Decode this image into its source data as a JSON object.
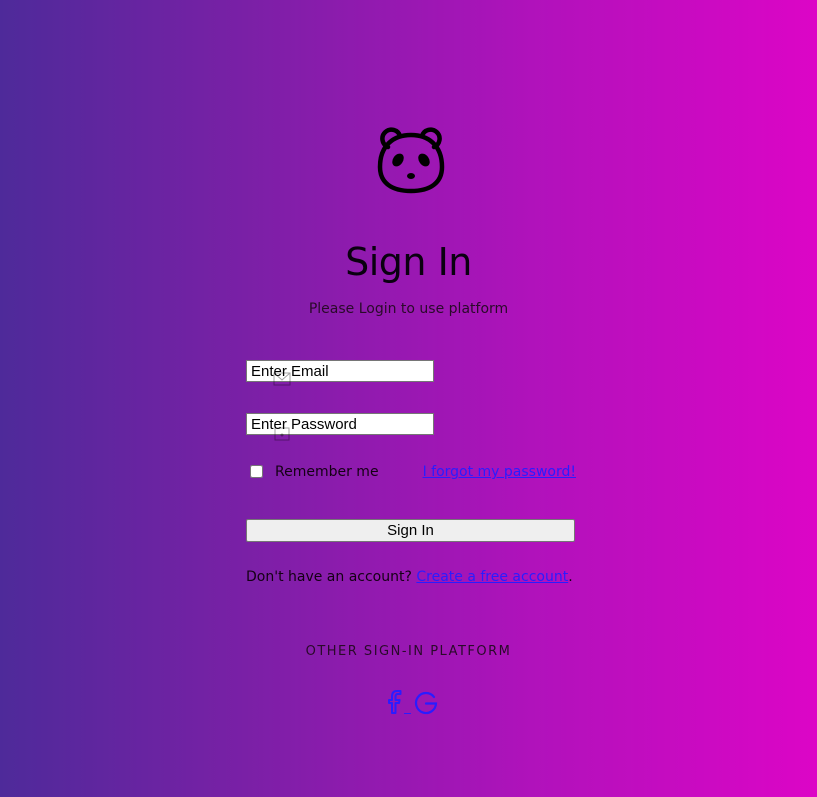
{
  "header": {
    "logo_icon": "panda-icon",
    "title": "Sign In",
    "subtitle": "Please Login to use platform"
  },
  "form": {
    "email_placeholder": "Enter Email",
    "email_icon": "envelope-icon",
    "password_placeholder": "Enter Password",
    "password_icon": "lock-icon",
    "remember_label": "Remember me",
    "remember_checked": false,
    "forgot_link": "I forgot my password!",
    "submit_label": "Sign In"
  },
  "signup": {
    "prompt": "Don't have an account? ",
    "link": "Create a free account",
    "suffix": "."
  },
  "other_platforms": {
    "title": "OTHER SIGN-IN PLATFORM",
    "icons": [
      "facebook-icon",
      "google-icon"
    ]
  },
  "colors": {
    "gradient_start": "#4e2a9a",
    "gradient_end": "#dc05c6",
    "link": "#2a1cff"
  }
}
